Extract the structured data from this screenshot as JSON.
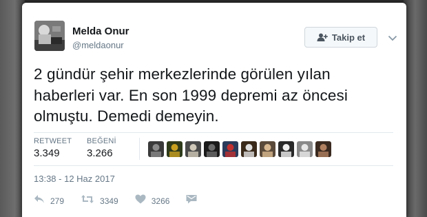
{
  "user": {
    "name": "Melda Onur",
    "handle": "@meldaonur"
  },
  "follow_button": {
    "label": "Takip et",
    "icon": "follow-user-icon"
  },
  "tweet": {
    "lines": [
      "2 gündür şehir merkezlerinde görülen yılan",
      "haberleri var. En son 1999 depremi az öncesi",
      "olmuştu. Demedi demeyin."
    ]
  },
  "stats": {
    "retweet_label": "RETWEET",
    "retweet_count": "3.349",
    "like_label": "BEĞENİ",
    "like_count": "3.266",
    "likers_count": 10
  },
  "timestamp": "13:38 - 12 Haz 2017",
  "actions": {
    "reply_count": "279",
    "retweet_count": "3349",
    "like_count": "3266",
    "icons": [
      "reply-icon",
      "retweet-icon",
      "heart-icon",
      "direct-message-icon"
    ]
  },
  "colors": {
    "text": "#14171a",
    "muted": "#657786",
    "divider": "#e1e8ed",
    "action_icon": "#aab8c2"
  }
}
